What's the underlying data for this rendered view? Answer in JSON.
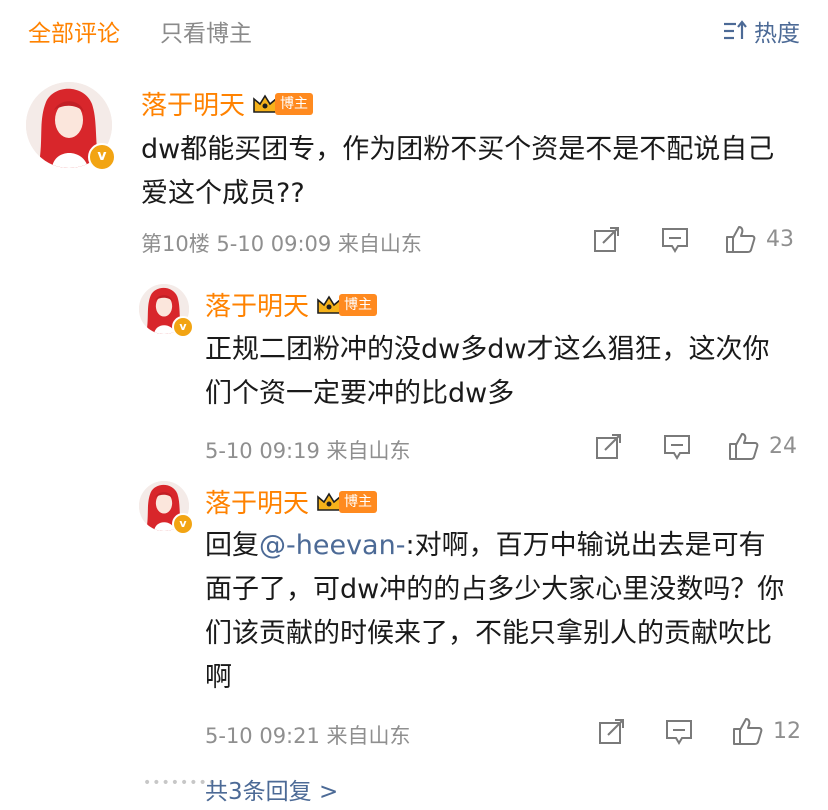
{
  "tabs": {
    "all": "全部评论",
    "op_only": "只看博主"
  },
  "sort": {
    "label": "热度",
    "icon": "sort-icon"
  },
  "op_badge": "博主",
  "main_comment": {
    "author": "落于明天",
    "text": "dw都能买团专，作为团粉不买个资是不是不配说自己爱这个成员??",
    "meta": "第10楼  5-10 09:09  来自山东",
    "likes": "43"
  },
  "replies": [
    {
      "author": "落于明天",
      "text": "正规二团粉冲的没dw多dw才这么猖狂，这次你们个资一定要冲的比dw多",
      "meta": "5-10 09:19  来自山东",
      "likes": "24"
    },
    {
      "author": "落于明天",
      "prefix": "回复",
      "mention": "@-heevan-",
      "text": ":对啊，百万中输说出去是可有面子了，可dw冲的的占多少大家心里没数吗？你们该贡献的时候来了，不能只拿别人的贡献吹比啊",
      "meta": "5-10 09:21  来自山东",
      "likes": "12"
    }
  ],
  "more_replies": "共3条回复 >",
  "colors": {
    "accent": "#ff8200",
    "link": "#4c6a96",
    "meta": "#8f8f8f"
  }
}
